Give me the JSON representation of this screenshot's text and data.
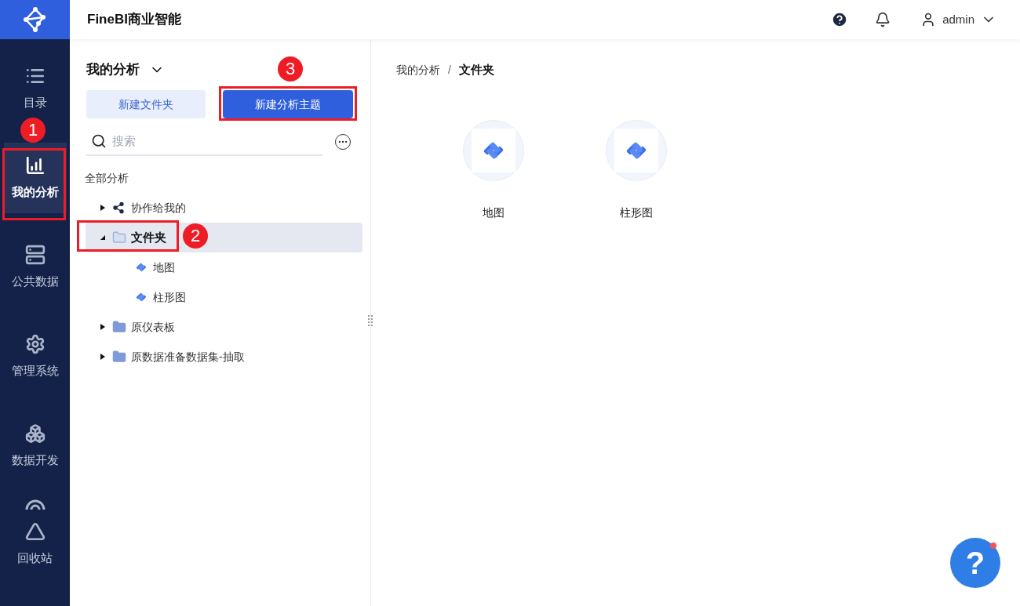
{
  "app": {
    "title": "FineBI商业智能"
  },
  "nav": [
    {
      "label": "目录",
      "selected": false
    },
    {
      "label": "我的分析",
      "selected": true
    },
    {
      "label": "公共数据",
      "selected": false
    },
    {
      "label": "管理系统",
      "selected": false
    },
    {
      "label": "数据开发",
      "selected": false
    },
    {
      "label": "回收站",
      "selected": false
    }
  ],
  "user": {
    "name": "admin"
  },
  "panel": {
    "title": "我的分析",
    "buttons": [
      {
        "label": "新建文件夹",
        "kind": "secondary"
      },
      {
        "label": "新建分析主题",
        "kind": "primary"
      }
    ],
    "search": {
      "placeholder": "搜索"
    },
    "root": "全部分析",
    "tree": [
      {
        "label": "协作给我的",
        "kind": "shared",
        "expanded": false,
        "selected": false
      },
      {
        "label": "文件夹",
        "kind": "folder",
        "expanded": true,
        "selected": true,
        "children": [
          {
            "label": "地图",
            "kind": "analysis",
            "selected": false
          },
          {
            "label": "柱形图",
            "kind": "analysis",
            "selected": false
          }
        ]
      },
      {
        "label": "原仪表板",
        "kind": "folder",
        "expanded": false,
        "selected": false
      },
      {
        "label": "原数据准备数据集-抽取",
        "kind": "folder",
        "expanded": false,
        "selected": false
      }
    ]
  },
  "breadcrumb": {
    "separator": "/",
    "items": [
      "我的分析",
      "文件夹"
    ]
  },
  "items": [
    {
      "label": "地图"
    },
    {
      "label": "柱形图"
    }
  ],
  "help_button": {
    "label": "?"
  },
  "callouts": [
    {
      "number": "1"
    },
    {
      "number": "2"
    },
    {
      "number": "3"
    }
  ]
}
